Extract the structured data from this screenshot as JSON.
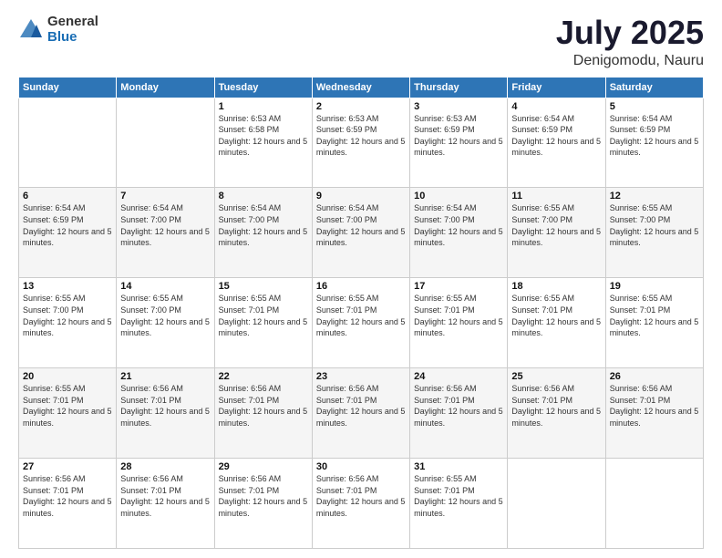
{
  "logo": {
    "general": "General",
    "blue": "Blue"
  },
  "title": "July 2025",
  "location": "Denigomodu, Nauru",
  "days_of_week": [
    "Sunday",
    "Monday",
    "Tuesday",
    "Wednesday",
    "Thursday",
    "Friday",
    "Saturday"
  ],
  "weeks": [
    [
      {
        "day": "",
        "info": ""
      },
      {
        "day": "",
        "info": ""
      },
      {
        "day": "1",
        "info": "Sunrise: 6:53 AM\nSunset: 6:58 PM\nDaylight: 12 hours and 5 minutes."
      },
      {
        "day": "2",
        "info": "Sunrise: 6:53 AM\nSunset: 6:59 PM\nDaylight: 12 hours and 5 minutes."
      },
      {
        "day": "3",
        "info": "Sunrise: 6:53 AM\nSunset: 6:59 PM\nDaylight: 12 hours and 5 minutes."
      },
      {
        "day": "4",
        "info": "Sunrise: 6:54 AM\nSunset: 6:59 PM\nDaylight: 12 hours and 5 minutes."
      },
      {
        "day": "5",
        "info": "Sunrise: 6:54 AM\nSunset: 6:59 PM\nDaylight: 12 hours and 5 minutes."
      }
    ],
    [
      {
        "day": "6",
        "info": "Sunrise: 6:54 AM\nSunset: 6:59 PM\nDaylight: 12 hours and 5 minutes."
      },
      {
        "day": "7",
        "info": "Sunrise: 6:54 AM\nSunset: 7:00 PM\nDaylight: 12 hours and 5 minutes."
      },
      {
        "day": "8",
        "info": "Sunrise: 6:54 AM\nSunset: 7:00 PM\nDaylight: 12 hours and 5 minutes."
      },
      {
        "day": "9",
        "info": "Sunrise: 6:54 AM\nSunset: 7:00 PM\nDaylight: 12 hours and 5 minutes."
      },
      {
        "day": "10",
        "info": "Sunrise: 6:54 AM\nSunset: 7:00 PM\nDaylight: 12 hours and 5 minutes."
      },
      {
        "day": "11",
        "info": "Sunrise: 6:55 AM\nSunset: 7:00 PM\nDaylight: 12 hours and 5 minutes."
      },
      {
        "day": "12",
        "info": "Sunrise: 6:55 AM\nSunset: 7:00 PM\nDaylight: 12 hours and 5 minutes."
      }
    ],
    [
      {
        "day": "13",
        "info": "Sunrise: 6:55 AM\nSunset: 7:00 PM\nDaylight: 12 hours and 5 minutes."
      },
      {
        "day": "14",
        "info": "Sunrise: 6:55 AM\nSunset: 7:00 PM\nDaylight: 12 hours and 5 minutes."
      },
      {
        "day": "15",
        "info": "Sunrise: 6:55 AM\nSunset: 7:01 PM\nDaylight: 12 hours and 5 minutes."
      },
      {
        "day": "16",
        "info": "Sunrise: 6:55 AM\nSunset: 7:01 PM\nDaylight: 12 hours and 5 minutes."
      },
      {
        "day": "17",
        "info": "Sunrise: 6:55 AM\nSunset: 7:01 PM\nDaylight: 12 hours and 5 minutes."
      },
      {
        "day": "18",
        "info": "Sunrise: 6:55 AM\nSunset: 7:01 PM\nDaylight: 12 hours and 5 minutes."
      },
      {
        "day": "19",
        "info": "Sunrise: 6:55 AM\nSunset: 7:01 PM\nDaylight: 12 hours and 5 minutes."
      }
    ],
    [
      {
        "day": "20",
        "info": "Sunrise: 6:55 AM\nSunset: 7:01 PM\nDaylight: 12 hours and 5 minutes."
      },
      {
        "day": "21",
        "info": "Sunrise: 6:56 AM\nSunset: 7:01 PM\nDaylight: 12 hours and 5 minutes."
      },
      {
        "day": "22",
        "info": "Sunrise: 6:56 AM\nSunset: 7:01 PM\nDaylight: 12 hours and 5 minutes."
      },
      {
        "day": "23",
        "info": "Sunrise: 6:56 AM\nSunset: 7:01 PM\nDaylight: 12 hours and 5 minutes."
      },
      {
        "day": "24",
        "info": "Sunrise: 6:56 AM\nSunset: 7:01 PM\nDaylight: 12 hours and 5 minutes."
      },
      {
        "day": "25",
        "info": "Sunrise: 6:56 AM\nSunset: 7:01 PM\nDaylight: 12 hours and 5 minutes."
      },
      {
        "day": "26",
        "info": "Sunrise: 6:56 AM\nSunset: 7:01 PM\nDaylight: 12 hours and 5 minutes."
      }
    ],
    [
      {
        "day": "27",
        "info": "Sunrise: 6:56 AM\nSunset: 7:01 PM\nDaylight: 12 hours and 5 minutes."
      },
      {
        "day": "28",
        "info": "Sunrise: 6:56 AM\nSunset: 7:01 PM\nDaylight: 12 hours and 5 minutes."
      },
      {
        "day": "29",
        "info": "Sunrise: 6:56 AM\nSunset: 7:01 PM\nDaylight: 12 hours and 5 minutes."
      },
      {
        "day": "30",
        "info": "Sunrise: 6:56 AM\nSunset: 7:01 PM\nDaylight: 12 hours and 5 minutes."
      },
      {
        "day": "31",
        "info": "Sunrise: 6:55 AM\nSunset: 7:01 PM\nDaylight: 12 hours and 5 minutes."
      },
      {
        "day": "",
        "info": ""
      },
      {
        "day": "",
        "info": ""
      }
    ]
  ]
}
